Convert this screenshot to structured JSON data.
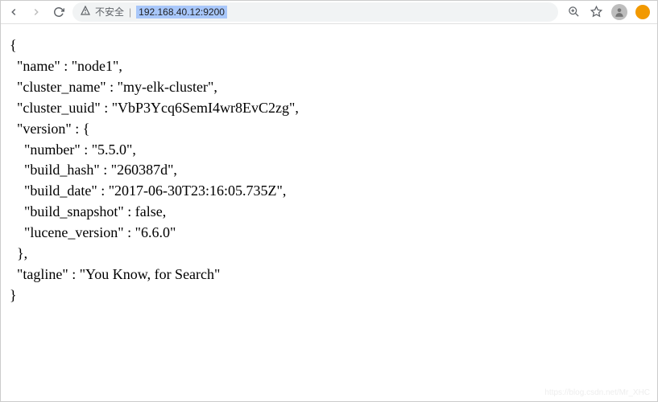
{
  "toolbar": {
    "insecure_label": "不安全",
    "url": "192.168.40.12:9200"
  },
  "response": {
    "name": "node1",
    "cluster_name": "my-elk-cluster",
    "cluster_uuid": "VbP3Ycq6SemI4wr8EvC2zg",
    "version": {
      "number": "5.5.0",
      "build_hash": "260387d",
      "build_date": "2017-06-30T23:16:05.735Z",
      "build_snapshot": "false",
      "lucene_version": "6.6.0"
    },
    "tagline": "You Know, for Search"
  },
  "watermark": "https://blog.csdn.net/Mr_XHC"
}
